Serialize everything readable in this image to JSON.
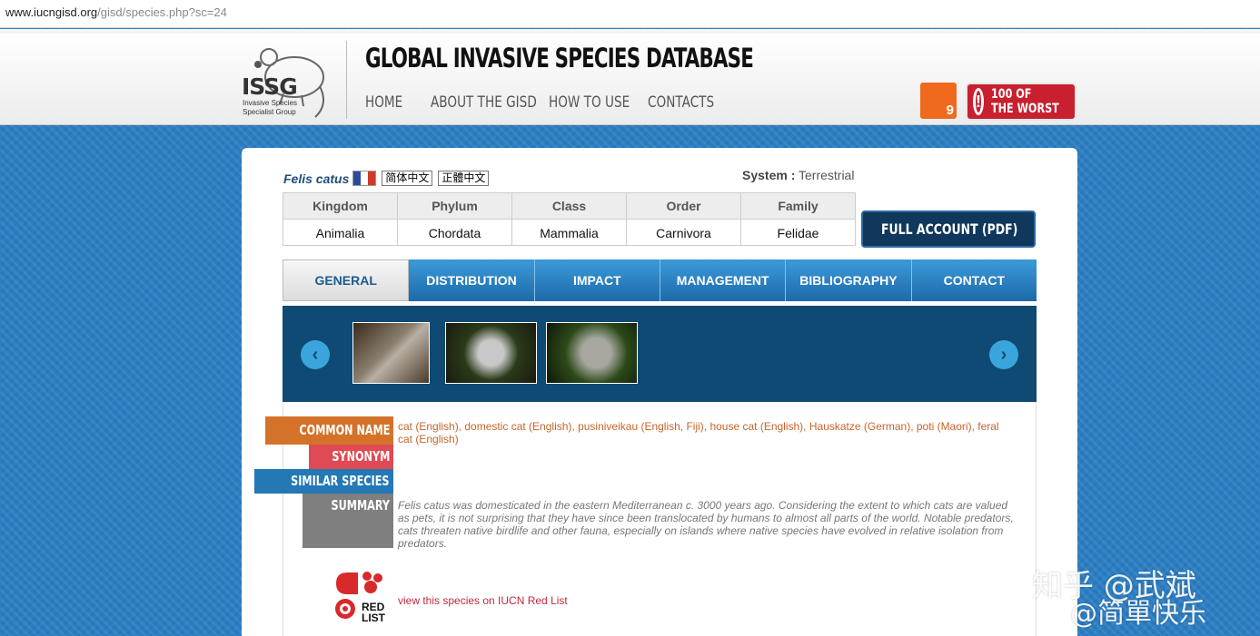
{
  "url": {
    "host": "www.iucngisd.org",
    "path": "/gisd/species.php?sc=24"
  },
  "header": {
    "logo_text": "ISSG",
    "logo_sub": [
      "Invasive Species",
      "Specialist Group"
    ],
    "title": "GLOBAL INVASIVE SPECIES DATABASE",
    "nav": [
      "HOME",
      "ABOUT THE GISD",
      "HOW TO USE",
      "CONTACTS"
    ],
    "badge_number": "9",
    "worst_button": [
      "100 OF",
      "THE WORST"
    ]
  },
  "species": {
    "name": "Felis catus",
    "lang_simplified": "简体中文",
    "lang_traditional": "正體中文",
    "system_label": "System :",
    "system_value": "Terrestrial"
  },
  "taxonomy": {
    "headers": [
      "Kingdom",
      "Phylum",
      "Class",
      "Order",
      "Family"
    ],
    "values": [
      "Animalia",
      "Chordata",
      "Mammalia",
      "Carnivora",
      "Felidae"
    ]
  },
  "full_account_label": "FULL ACCOUNT (PDF)",
  "tabs": [
    "GENERAL",
    "DISTRIBUTION",
    "IMPACT",
    "MANAGEMENT",
    "BIBLIOGRAPHY",
    "CONTACT"
  ],
  "active_tab": "GENERAL",
  "sections": {
    "common_name_label": "COMMON NAME",
    "common_name_text": "cat (English), domestic cat (English), pusiniveikau (English, Fiji), house cat (English), Hauskatze (German), poti (Maori), feral cat (English)",
    "synonym_label": "SYNONYM",
    "similar_label": "SIMILAR SPECIES",
    "summary_label": "SUMMARY",
    "summary_text": "Felis catus was domesticated in the eastern Mediterranean c. 3000 years ago. Considering the extent to which cats are valued as pets, it is not surprising that they have since been translocated by humans to almost all parts of the world. Notable predators, cats threaten native birdlife and other fauna, especially on islands where native species have evolved in relative isolation from predators.",
    "redlist_logo": "RED LIST",
    "redlist_link": "view this species on IUCN Red List"
  },
  "watermark": {
    "line1": "知乎 @武斌",
    "line2": "@简單快乐"
  },
  "colors": {
    "common_name": "#d4722a",
    "synonym": "#e04a55",
    "similar": "#2378b5",
    "summary": "#7f7f7f",
    "tab_blue": "#1c6aab"
  }
}
